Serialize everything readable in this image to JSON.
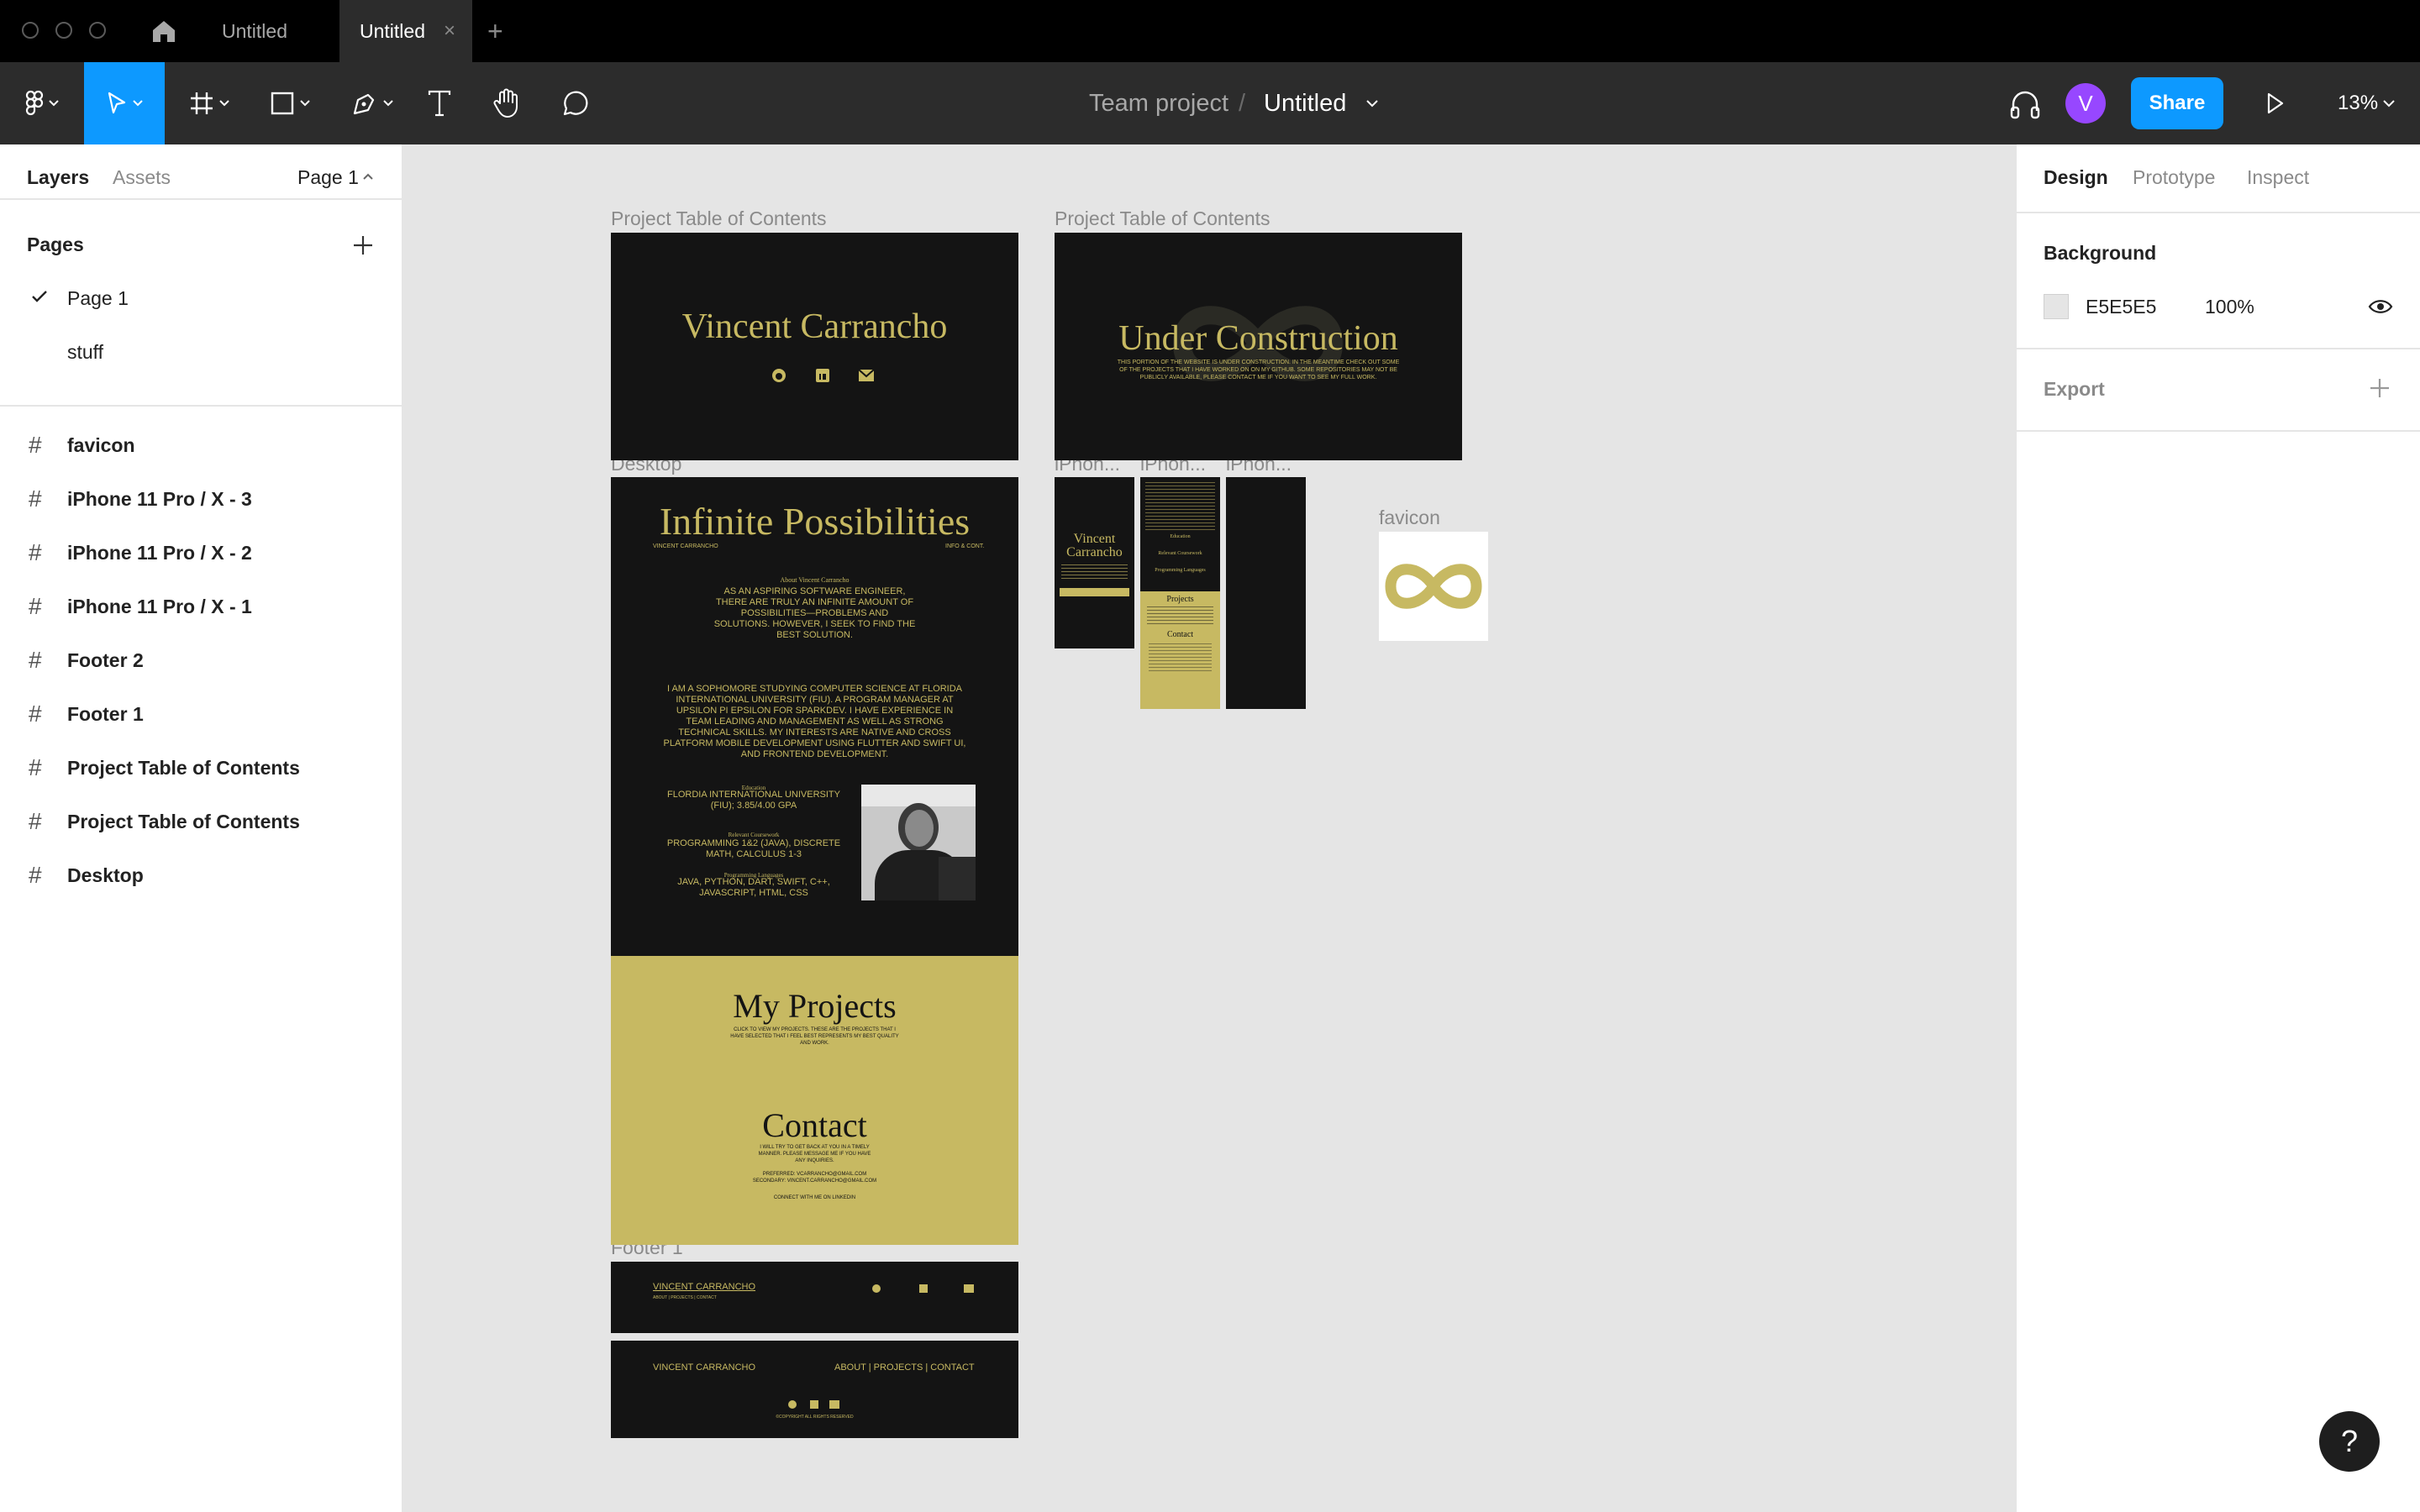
{
  "tabs": {
    "home_icon": "home-icon",
    "items": [
      {
        "label": "Untitled"
      },
      {
        "label": "Untitled",
        "close": "×"
      }
    ],
    "new_tab": "+"
  },
  "toolbar": {
    "tools": [
      "figma-menu-icon",
      "move-tool-icon",
      "frame-tool-icon",
      "shape-tool-icon",
      "pen-tool-icon",
      "text-tool-icon",
      "hand-tool-icon",
      "comment-tool-icon"
    ],
    "team": "Team project",
    "separator": "/",
    "file_name": "Untitled",
    "avatar": "V",
    "share_label": "Share",
    "zoom": "13%"
  },
  "left_panel": {
    "tabs": {
      "layers": "Layers",
      "assets": "Assets",
      "page": "Page 1"
    },
    "pages_title": "Pages",
    "pages": [
      {
        "label": "Page 1",
        "selected": true
      },
      {
        "label": "stuff",
        "selected": false
      }
    ],
    "layers": [
      "favicon",
      "iPhone 11 Pro / X - 3",
      "iPhone 11 Pro / X - 2",
      "iPhone 11 Pro / X - 1",
      "Footer 2",
      "Footer 1",
      "Project Table of Contents",
      "Project Table of Contents",
      "Desktop"
    ]
  },
  "right_panel": {
    "tabs": {
      "design": "Design",
      "prototype": "Prototype",
      "inspect": "Inspect"
    },
    "background_title": "Background",
    "background_color": "E5E5E5",
    "background_opacity": "100%",
    "export_title": "Export"
  },
  "canvas": {
    "labels": {
      "toc1": "Project Table of Contents",
      "toc2": "Project Table of Contents",
      "desktop": "Desktop",
      "iphone1": "iPhon...",
      "iphone2": "iPhon...",
      "iphone3": "iPhon...",
      "favicon": "favicon",
      "footer1": "Footer 1"
    },
    "toc1": {
      "name": "Vincent Carrancho"
    },
    "toc2": {
      "heading": "Under Construction",
      "body": "THIS PORTION OF THE WEBSITE IS UNDER CONSTRUCTION. IN THE MEANTIME CHECK OUT SOME OF THE PROJECTS THAT I HAVE WORKED ON ON MY GITHUB. SOME REPOSITORIES MAY NOT BE PUBLICLY AVAILABLE, PLEASE CONTACT ME IF YOU WANT TO SEE MY FULL WORK."
    },
    "desktop": {
      "title": "Infinite Possibilities",
      "sub_left": "VINCENT CARRANCHO",
      "sub_right": "INFO & CONT.",
      "about_title": "About Vincent Carrancho",
      "para1": "AS AN ASPIRING SOFTWARE ENGINEER, THERE ARE TRULY AN INFINITE AMOUNT OF POSSIBILITIES—PROBLEMS AND SOLUTIONS. HOWEVER, I SEEK TO FIND THE BEST SOLUTION.",
      "para2": "I AM A SOPHOMORE STUDYING COMPUTER SCIENCE AT FLORIDA INTERNATIONAL UNIVERSITY (FIU). A PROGRAM MANAGER AT UPSILON PI EPSILON FOR SPARKDEV. I HAVE EXPERIENCE IN TEAM LEADING AND MANAGEMENT AS WELL AS STRONG TECHNICAL SKILLS. MY INTERESTS ARE NATIVE AND CROSS PLATFORM MOBILE DEVELOPMENT USING FLUTTER AND SWIFT UI, AND FRONTEND DEVELOPMENT.",
      "edu_title": "Education",
      "edu": "FLORDIA INTERNATIONAL UNIVERSITY (FIU); 3.85/4.00 GPA",
      "course_title": "Relevant Coursework",
      "course": "PROGRAMMING 1&2 (JAVA), DISCRETE MATH, CALCULUS 1-3",
      "lang_title": "Programming Languages",
      "lang": "JAVA, PYTHON, DART, SWIFT, C++, JAVASCRIPT, HTML, CSS",
      "projects_title": "My Projects",
      "projects_sub": "CLICK TO VIEW MY PROJECTS. THESE ARE THE PROJECTS THAT I HAVE SELECTED THAT I FEEL BEST REPRESENTS MY BEST QUALITY AND WORK.",
      "contact_title": "Contact",
      "contact_sub": "I WILL TRY TO GET BACK AT YOU IN A TIMELY MANNER. PLEASE MESSAGE ME IF YOU HAVE ANY INQUIRIES.",
      "contact_email": "PREFERRED: VCARRANCHO@GMAIL.COM",
      "contact_email2": "SECONDARY: VINCENT.CARRANCHO@GMAIL.COM",
      "contact_link": "CONNECT WITH ME ON LINKEDIN"
    },
    "iphone1": {
      "name": "Vincent Carrancho"
    },
    "iphone2": {
      "s1": "Education",
      "s2": "Relevant Coursework",
      "s3": "Programming Languages",
      "s4": "Projects",
      "s5": "Contact"
    },
    "footer1": {
      "name": "VINCENT CARRANCHO",
      "links": "ABOUT | PROJECTS | CONTACT"
    },
    "footer2": {
      "name": "VINCENT CARRANCHO",
      "links": "ABOUT | PROJECTS | CONTACT",
      "copyright": "©COPYRIGHT ALL RIGHTS RESERVED"
    }
  },
  "help": "?",
  "colors": {
    "accent": "#0d99ff",
    "gold": "#c7b962",
    "frame": "#141414",
    "canvas": "#e5e5e5"
  }
}
